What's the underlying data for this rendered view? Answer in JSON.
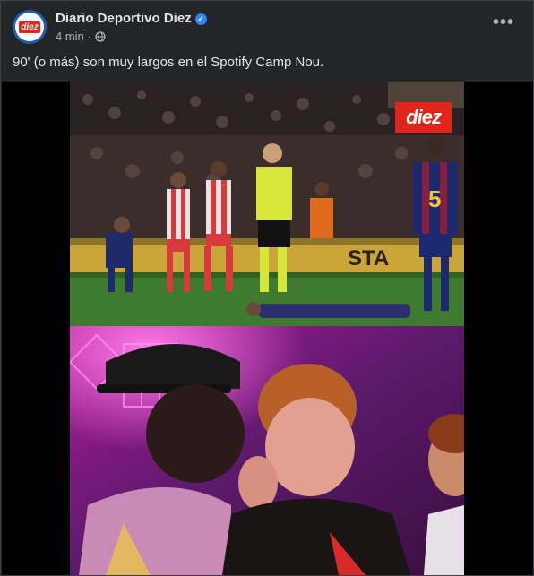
{
  "post": {
    "page_name": "Diario Deportivo Diez",
    "time": "4 min",
    "separator": "·",
    "more_label": "•••",
    "caption": "90' (o más) son muy largos en el Spotify Camp Nou.",
    "avatar_logo_text": "diez",
    "brand_badge_text": "diez",
    "verified_glyph": "✓"
  },
  "colors": {
    "background": "#242526",
    "text_primary": "#e4e6eb",
    "text_secondary": "#b0b3b8",
    "brand_red": "#e1251b",
    "verified_blue": "#2d88ff"
  },
  "icons": {
    "audience": "globe-icon",
    "verified": "verified-badge-icon",
    "more": "more-options-icon"
  }
}
